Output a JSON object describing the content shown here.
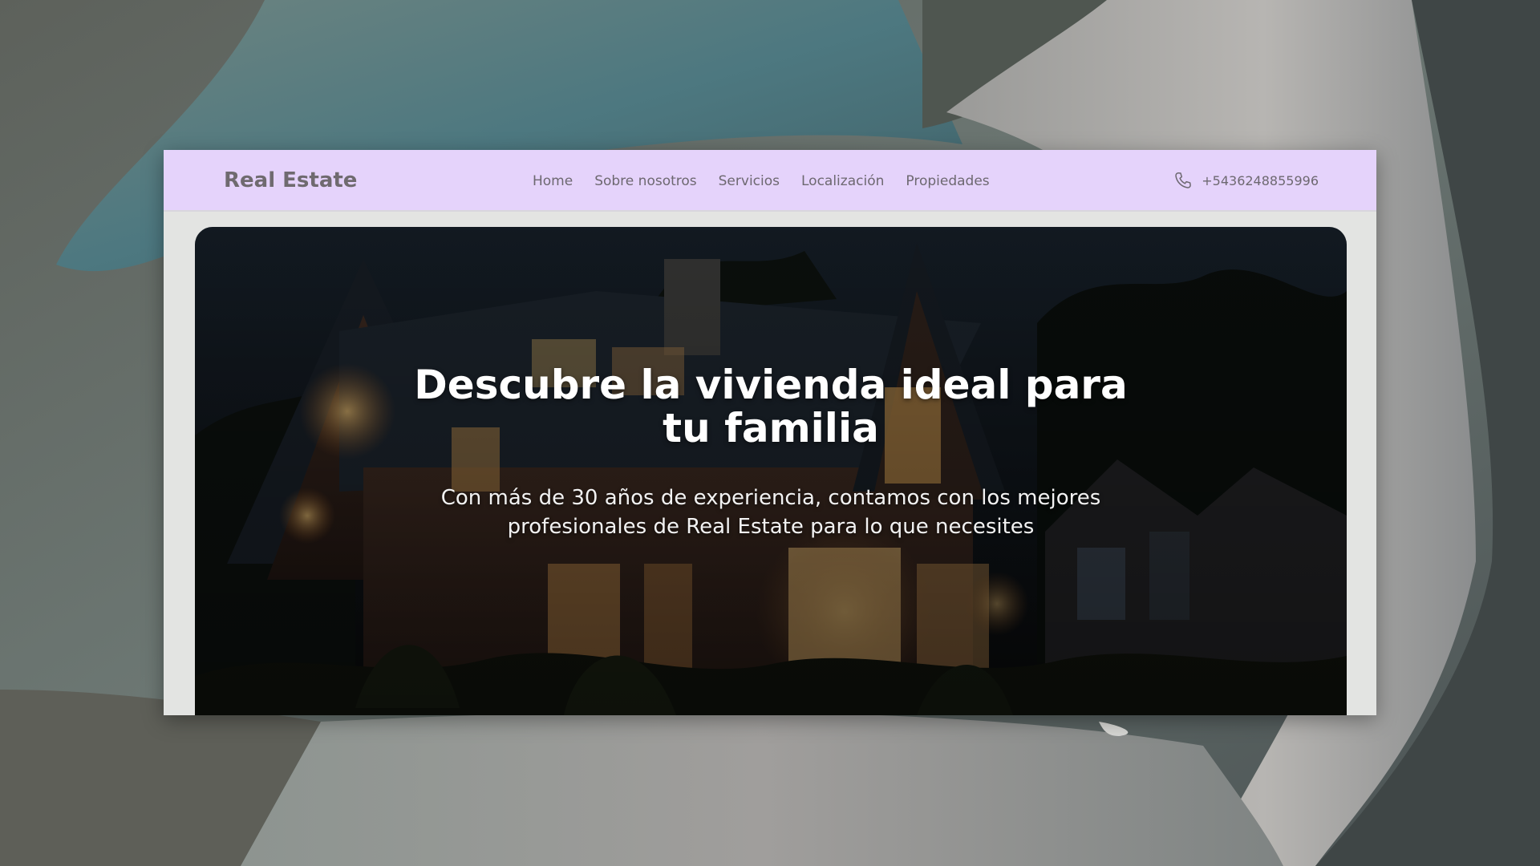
{
  "navbar": {
    "brand": "Real Estate",
    "links": [
      "Home",
      "Sobre nosotros",
      "Servicios",
      "Localización",
      "Propiedades"
    ],
    "phone_number": "+5436248855996",
    "phone_icon": "phone-icon",
    "background_color": "#e5d3fb"
  },
  "hero": {
    "title": "Descubre la vivienda ideal para tu familia",
    "subtitle": "Con más de 30 años de experiencia, contamos con los mejores profesionales de Real Estate para lo que necesites",
    "image": "house-at-night-photo"
  }
}
